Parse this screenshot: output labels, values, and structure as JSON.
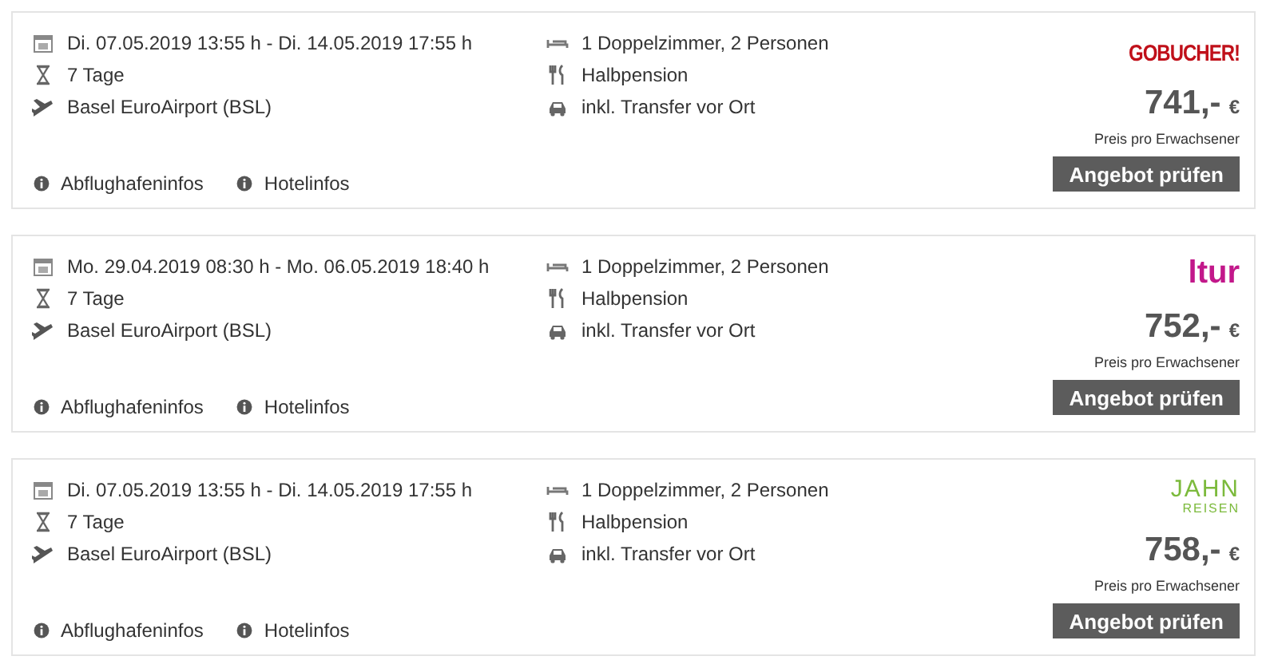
{
  "offers": [
    {
      "dates": "Di. 07.05.2019 13:55 h - Di. 14.05.2019 17:55 h",
      "duration": "7 Tage",
      "airport": "Basel EuroAirport (BSL)",
      "room": "1 Doppelzimmer, 2 Personen",
      "board": "Halbpension",
      "transfer": "inkl. Transfer vor Ort",
      "logo": {
        "kind": "gobucher",
        "lines": [
          "GOBUCHER!"
        ]
      },
      "price": "741,-",
      "currency": "€",
      "price_note": "Preis pro Erwachsener",
      "button": "Angebot prüfen",
      "links": [
        "Abflughafeninfos",
        "Hotelinfos"
      ]
    },
    {
      "dates": "Mo. 29.04.2019 08:30 h - Mo. 06.05.2019 18:40 h",
      "duration": "7 Tage",
      "airport": "Basel EuroAirport (BSL)",
      "room": "1 Doppelzimmer, 2 Personen",
      "board": "Halbpension",
      "transfer": "inkl. Transfer vor Ort",
      "logo": {
        "kind": "ltur",
        "lines": [
          "ltur"
        ]
      },
      "price": "752,-",
      "currency": "€",
      "price_note": "Preis pro Erwachsener",
      "button": "Angebot prüfen",
      "links": [
        "Abflughafeninfos",
        "Hotelinfos"
      ]
    },
    {
      "dates": "Di. 07.05.2019 13:55 h - Di. 14.05.2019 17:55 h",
      "duration": "7 Tage",
      "airport": "Basel EuroAirport (BSL)",
      "room": "1 Doppelzimmer, 2 Personen",
      "board": "Halbpension",
      "transfer": "inkl. Transfer vor Ort",
      "logo": {
        "kind": "jahn",
        "lines": [
          "JAHN",
          "REISEN"
        ]
      },
      "price": "758,-",
      "currency": "€",
      "price_note": "Preis pro Erwachsener",
      "button": "Angebot prüfen",
      "links": [
        "Abflughafeninfos",
        "Hotelinfos"
      ]
    }
  ]
}
